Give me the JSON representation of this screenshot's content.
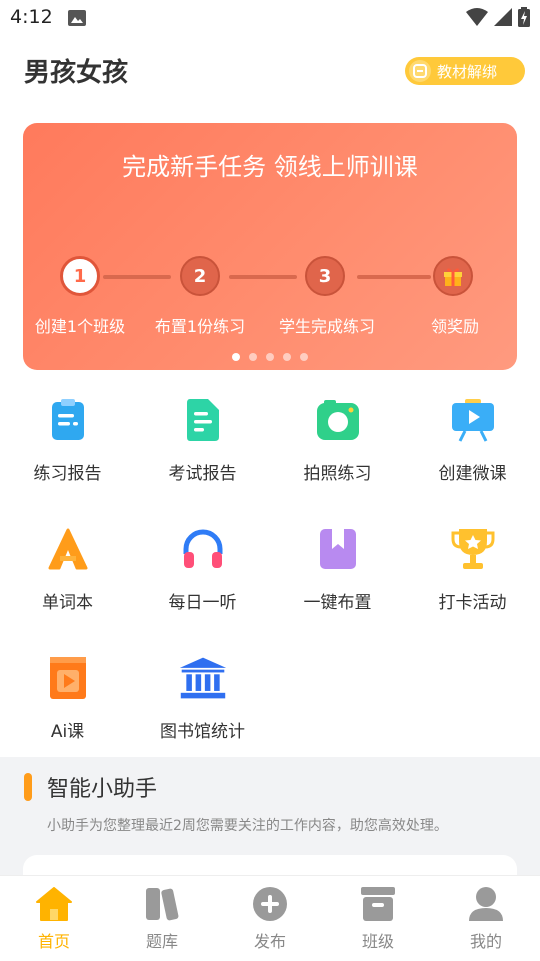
{
  "status_bar": {
    "time": "4:12"
  },
  "header": {
    "title": "男孩女孩",
    "bind_button_label": "教材解绑"
  },
  "banner": {
    "title": "完成新手任务 领线上师训课",
    "steps": [
      {
        "number": "1",
        "label": "创建1个班级"
      },
      {
        "number": "2",
        "label": "布置1份练习"
      },
      {
        "number": "3",
        "label": "学生完成练习"
      },
      {
        "label": "领奖励"
      }
    ],
    "carousel": {
      "count": 5,
      "active_index": 0
    }
  },
  "grid": [
    {
      "label": "练习报告",
      "icon": "clipboard-icon"
    },
    {
      "label": "考试报告",
      "icon": "document-icon"
    },
    {
      "label": "拍照练习",
      "icon": "camera-icon"
    },
    {
      "label": "创建微课",
      "icon": "video-board-icon"
    },
    {
      "label": "单词本",
      "icon": "letter-a-icon"
    },
    {
      "label": "每日一听",
      "icon": "headphones-icon"
    },
    {
      "label": "一键布置",
      "icon": "bookmark-book-icon"
    },
    {
      "label": "打卡活动",
      "icon": "trophy-icon"
    },
    {
      "label": "Ai课",
      "icon": "play-book-icon"
    },
    {
      "label": "图书馆统计",
      "icon": "library-icon"
    }
  ],
  "assistant": {
    "title": "智能小助手",
    "subtitle": "小助手为您整理最近2周您需要关注的工作内容，助您高效处理。"
  },
  "bottom_nav": [
    {
      "label": "首页",
      "icon": "home-icon",
      "active": true
    },
    {
      "label": "题库",
      "icon": "books-icon",
      "active": false
    },
    {
      "label": "发布",
      "icon": "plus-circle-icon",
      "active": false
    },
    {
      "label": "班级",
      "icon": "class-box-icon",
      "active": false
    },
    {
      "label": "我的",
      "icon": "person-icon",
      "active": false
    }
  ],
  "colors": {
    "accent": "#ffb300",
    "banner": "#ff7a5c",
    "inactive": "#888888"
  }
}
